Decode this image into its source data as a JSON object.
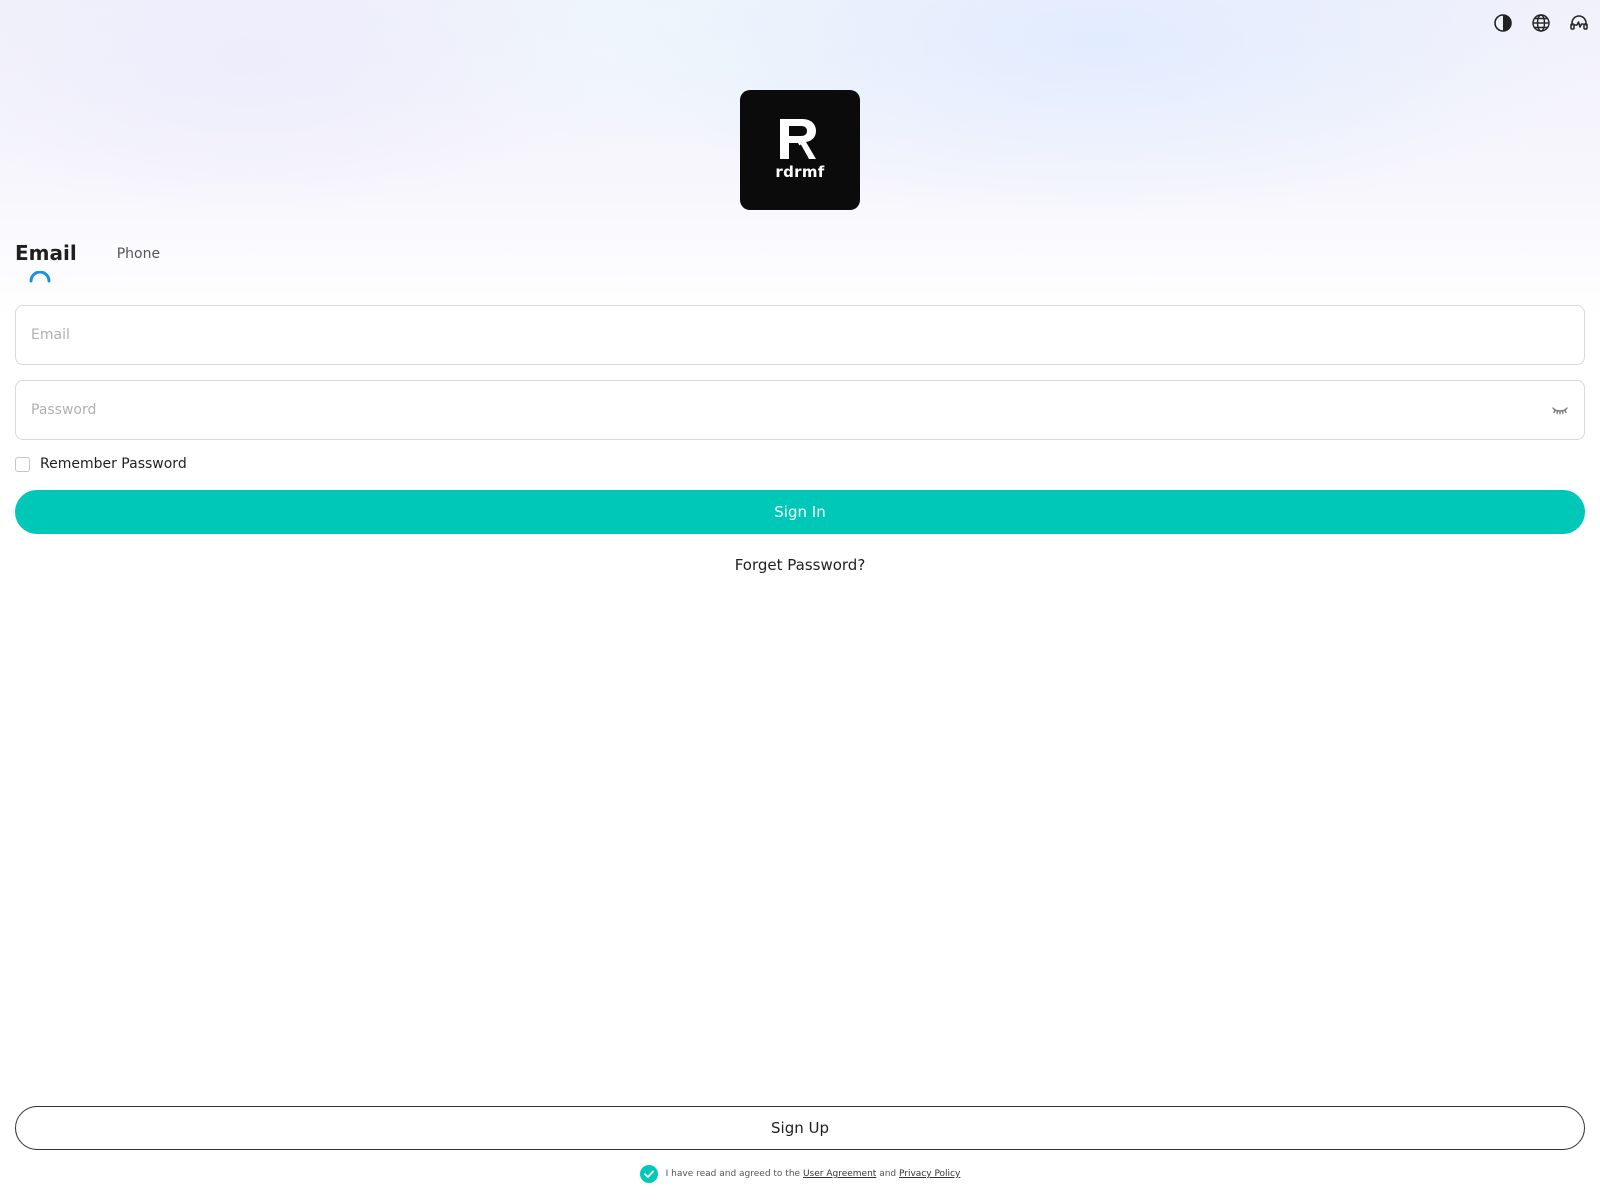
{
  "brand": {
    "logo_text": "rdrmf"
  },
  "top_icons": [
    "theme-contrast-icon",
    "language-globe-icon",
    "customer-support-icon"
  ],
  "tabs": [
    {
      "label": "Email",
      "active": true
    },
    {
      "label": "Phone",
      "active": false
    }
  ],
  "form": {
    "email_placeholder": "Email",
    "password_placeholder": "Password",
    "remember_label": "Remember Password",
    "remember_checked": false,
    "signin_label": "Sign In",
    "forget_label": "Forget Password?"
  },
  "signup_label": "Sign Up",
  "agreement": {
    "agreed": true,
    "prefix": "I have read and agreed to the",
    "user_agreement": "User Agreement",
    "conjunction": "and",
    "privacy_policy": "Privacy Policy"
  },
  "colors": {
    "accent": "#00c8b8",
    "tab_indicator": "#1a8fe3",
    "logo_bg": "#0b0b0b"
  }
}
